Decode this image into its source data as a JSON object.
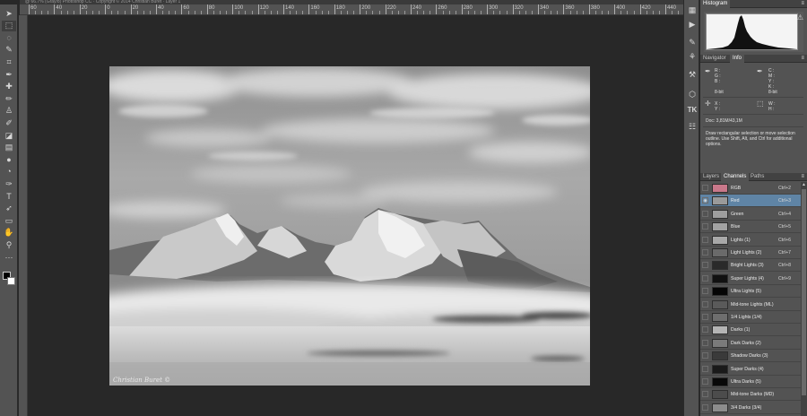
{
  "document": {
    "title_strip": "@ 66.7% (Gray/8) Photoshop CC · Copyright © 2014 Christian Buret · Layer 1"
  },
  "ruler": {
    "labels": [
      "60",
      "40",
      "20",
      "0",
      "20",
      "40",
      "60",
      "80",
      "100",
      "120",
      "140",
      "160",
      "180",
      "200",
      "220",
      "240",
      "260",
      "280",
      "300",
      "320",
      "340",
      "360",
      "380",
      "400",
      "420",
      "440"
    ]
  },
  "photo": {
    "signature": "Christian Buret ©"
  },
  "tools": [
    {
      "name": "move-tool-icon",
      "glyph": "➤"
    },
    {
      "name": "marquee-tool-icon",
      "glyph": "⬚"
    },
    {
      "name": "lasso-tool-icon",
      "glyph": "◌"
    },
    {
      "name": "quick-select-tool-icon",
      "glyph": "✎"
    },
    {
      "name": "crop-tool-icon",
      "glyph": "⌗"
    },
    {
      "name": "eyedropper-tool-icon",
      "glyph": "✒"
    },
    {
      "name": "healing-brush-tool-icon",
      "glyph": "✚"
    },
    {
      "name": "brush-tool-icon",
      "glyph": "✏"
    },
    {
      "name": "clone-stamp-tool-icon",
      "glyph": "♙"
    },
    {
      "name": "history-brush-tool-icon",
      "glyph": "✐"
    },
    {
      "name": "eraser-tool-icon",
      "glyph": "◪"
    },
    {
      "name": "gradient-tool-icon",
      "glyph": "▤"
    },
    {
      "name": "blur-tool-icon",
      "glyph": "●"
    },
    {
      "name": "dodge-tool-icon",
      "glyph": "◔"
    },
    {
      "name": "pen-tool-icon",
      "glyph": "✑"
    },
    {
      "name": "type-tool-icon",
      "glyph": "T"
    },
    {
      "name": "path-select-tool-icon",
      "glyph": "➶"
    },
    {
      "name": "shape-tool-icon",
      "glyph": "▭"
    },
    {
      "name": "hand-tool-icon",
      "glyph": "✋"
    },
    {
      "name": "zoom-tool-icon",
      "glyph": "⚲"
    },
    {
      "name": "more-tools-icon",
      "glyph": "···"
    }
  ],
  "dock": [
    {
      "name": "history-panel-icon",
      "glyph": "▦"
    },
    {
      "name": "play-action-icon",
      "glyph": "▶"
    },
    {
      "name": "brush-panel-icon",
      "glyph": "✎"
    },
    {
      "name": "brush-presets-icon",
      "glyph": "⚘"
    },
    {
      "name": "tool-presets-icon",
      "glyph": "⚒"
    },
    {
      "name": "3d-panel-icon",
      "glyph": "⬡"
    },
    {
      "name": "tk-panel-icon",
      "glyph": "TK"
    },
    {
      "name": "properties-panel-icon",
      "glyph": "☷"
    }
  ],
  "histogram_panel": {
    "tab": "Histogram",
    "menu": "≡",
    "warning": "⚠"
  },
  "info_panel": {
    "tabs": [
      "Navigator",
      "Info"
    ],
    "rgb_block": "R :\nG :\nB :\n\n8-bit",
    "cmyk_block": "C :\nM :\nY :\nK :\n8-bit",
    "xy_block": "X :\nY :",
    "wh_block": "W :\nH :",
    "doc_size": "Doc: 3,81M/43,1M",
    "hint": "Draw rectangular selection or move selection outline.  Use Shift, Alt, and Ctrl for additional options."
  },
  "channels_panel": {
    "tabs": [
      "Layers",
      "Channels",
      "Paths"
    ],
    "active_tab": "Channels",
    "rows": [
      {
        "name": "RGB",
        "shortcut": "Ctrl+2",
        "thumb": "#c9788a",
        "visible": false,
        "selected": false
      },
      {
        "name": "Red",
        "shortcut": "Ctrl+3",
        "thumb": "#9a9a9a",
        "visible": true,
        "selected": true
      },
      {
        "name": "Green",
        "shortcut": "Ctrl+4",
        "thumb": "#9e9e9e",
        "visible": false,
        "selected": false
      },
      {
        "name": "Blue",
        "shortcut": "Ctrl+5",
        "thumb": "#a2a2a2",
        "visible": false,
        "selected": false
      },
      {
        "name": "Lights (1)",
        "shortcut": "Ctrl+6",
        "thumb": "#a8a8a8",
        "visible": false,
        "selected": false
      },
      {
        "name": "Light Lights (2)",
        "shortcut": "Ctrl+7",
        "thumb": "#6a6a6a",
        "visible": false,
        "selected": false
      },
      {
        "name": "Bright Lights (3)",
        "shortcut": "Ctrl+8",
        "thumb": "#2a2a2a",
        "visible": false,
        "selected": false
      },
      {
        "name": "Super Lights (4)",
        "shortcut": "Ctrl+9",
        "thumb": "#111111",
        "visible": false,
        "selected": false
      },
      {
        "name": "Ultra Lights (5)",
        "shortcut": "",
        "thumb": "#050505",
        "visible": false,
        "selected": false
      },
      {
        "name": "Mid-tone Lights (ML)",
        "shortcut": "",
        "thumb": "#5a5a5a",
        "visible": false,
        "selected": false
      },
      {
        "name": "1/4 Lights (1/4)",
        "shortcut": "",
        "thumb": "#6e6e6e",
        "visible": false,
        "selected": false
      },
      {
        "name": "Darks (1)",
        "shortcut": "",
        "thumb": "#b4b4b4",
        "visible": false,
        "selected": false
      },
      {
        "name": "Dark Darks (2)",
        "shortcut": "",
        "thumb": "#7a7a7a",
        "visible": false,
        "selected": false
      },
      {
        "name": "Shadow Darks (3)",
        "shortcut": "",
        "thumb": "#3a3a3a",
        "visible": false,
        "selected": false
      },
      {
        "name": "Super Darks (4)",
        "shortcut": "",
        "thumb": "#1a1a1a",
        "visible": false,
        "selected": false
      },
      {
        "name": "Ultra Darks (5)",
        "shortcut": "",
        "thumb": "#080808",
        "visible": false,
        "selected": false
      },
      {
        "name": "Mid-tone Darks (MD)",
        "shortcut": "",
        "thumb": "#4c4c4c",
        "visible": false,
        "selected": false
      },
      {
        "name": "3/4 Darks (3/4)",
        "shortcut": "",
        "thumb": "#8c8c8c",
        "visible": false,
        "selected": false
      }
    ]
  }
}
